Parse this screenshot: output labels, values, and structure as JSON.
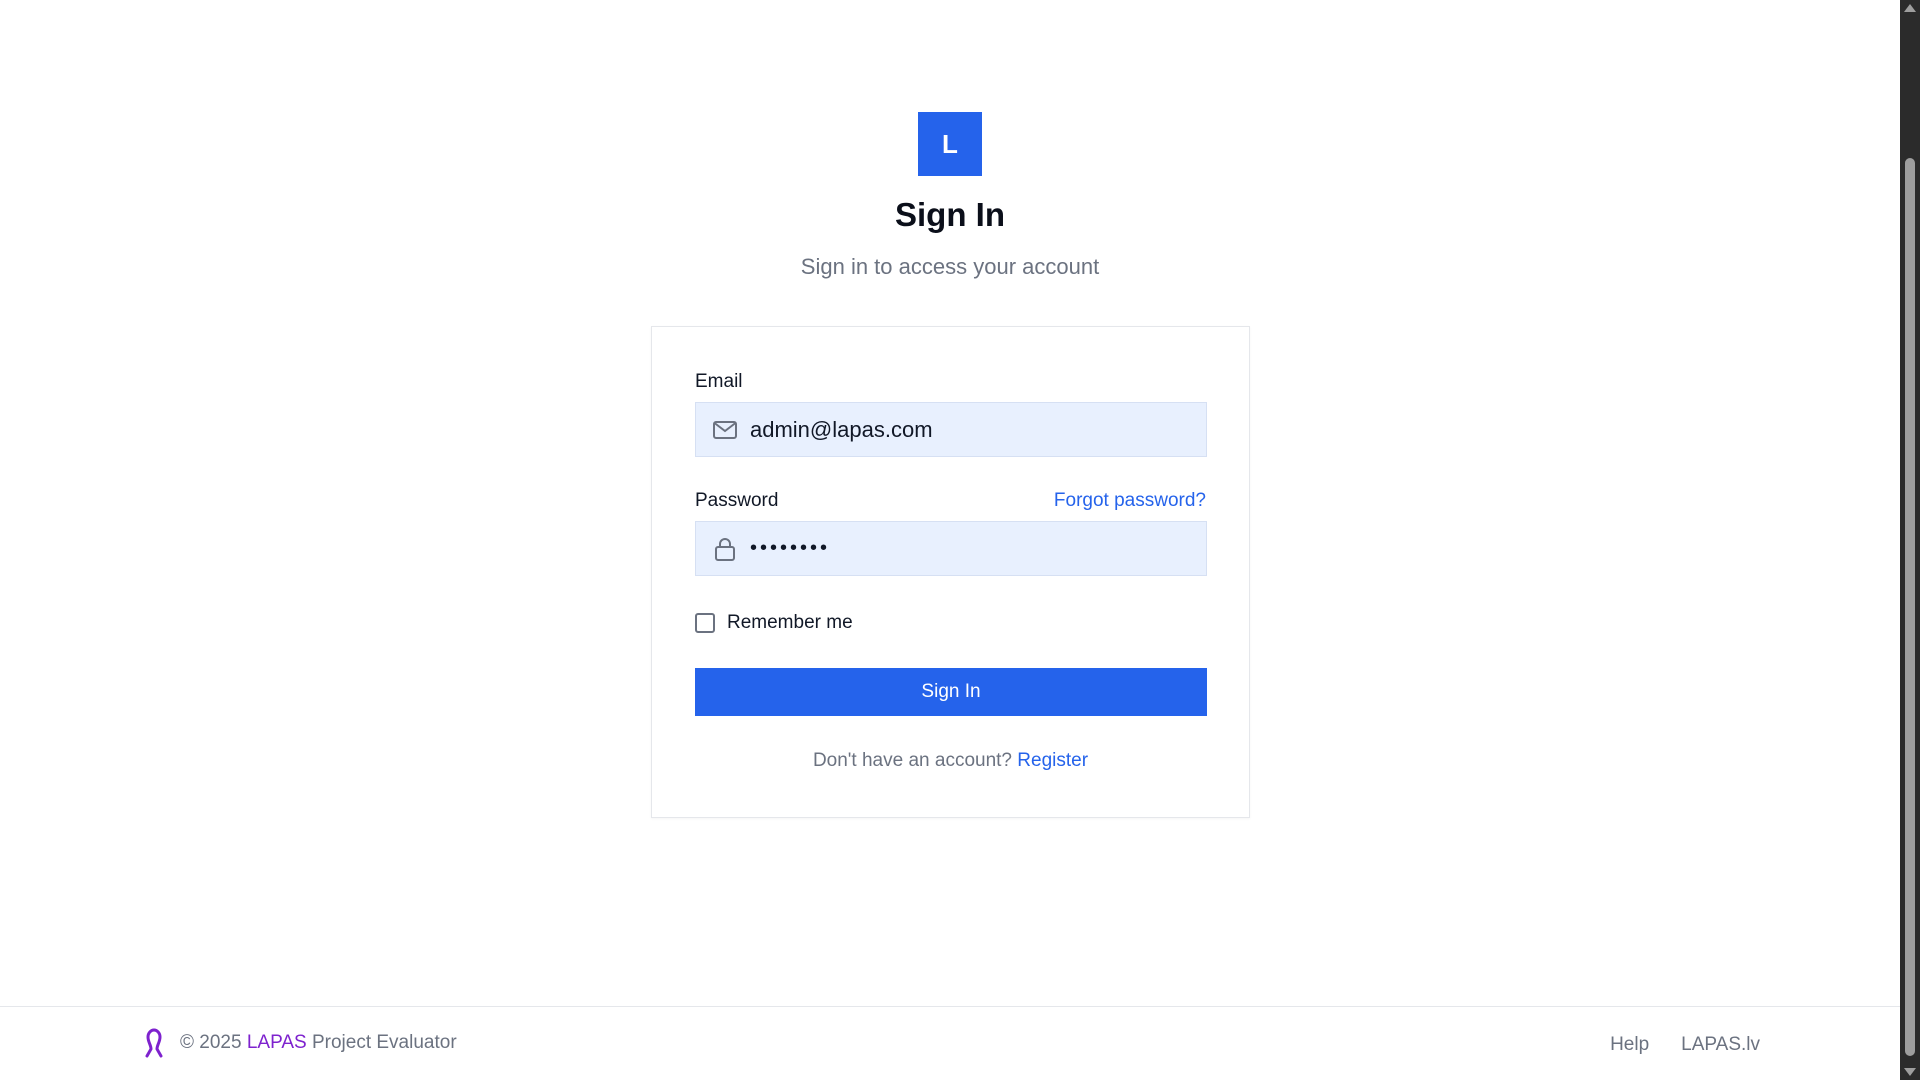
{
  "logo": {
    "letter": "L"
  },
  "header": {
    "title": "Sign In",
    "subtitle": "Sign in to access your account"
  },
  "form": {
    "email_label": "Email",
    "email_value": "admin@lapas.com",
    "password_label": "Password",
    "forgot_password": "Forgot password?",
    "password_value": "••••••••",
    "remember_label": "Remember me",
    "remember_checked": false,
    "submit_label": "Sign In",
    "register_prompt": "Don't have an account?",
    "register_link": "Register"
  },
  "footer": {
    "copyright_prefix": "© 2025",
    "brand": "LAPAS",
    "product": "Project Evaluator",
    "links": [
      "Help",
      "LAPAS.lv"
    ]
  },
  "icons": {
    "email": "mail-icon",
    "password": "lock-icon",
    "footer_logo": "lapas-logo-icon"
  },
  "colors": {
    "primary": "#2563eb",
    "input_bg": "#e8f0fe",
    "brand_purple": "#7e22ce",
    "muted_text": "#6b7280"
  }
}
